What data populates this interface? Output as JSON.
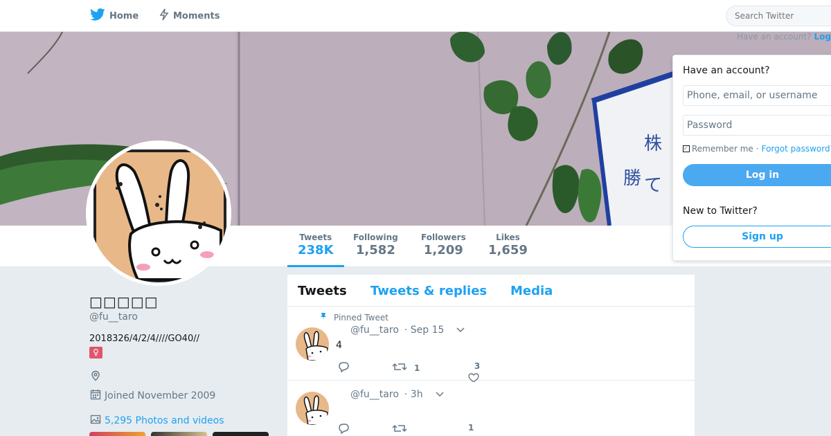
{
  "nav": {
    "home_label": "Home",
    "moments_label": "Moments",
    "search_placeholder": "Search Twitter",
    "have_account_prefix": "Have an account? ",
    "have_account_link": "Log in"
  },
  "colors": {
    "accent": "#1da1f2",
    "background": "#e6ecf0",
    "muted": "#657786",
    "gender_badge": "#e0556d"
  },
  "stats": {
    "tweets_label": "Tweets",
    "tweets_value": "238K",
    "following_label": "Following",
    "following_value": "1,582",
    "followers_label": "Followers",
    "followers_value": "1,209",
    "likes_label": "Likes",
    "likes_value": "1,659"
  },
  "profile": {
    "name": "□□□□□",
    "handle": "@fu__taro",
    "bio": "2018326/4/2/4////GO40//",
    "gender_symbol": "♀",
    "location_icon": "location-pin-icon",
    "joined": "Joined November 2009",
    "photos_link": "5,295 Photos and videos"
  },
  "timeline": {
    "tabs": [
      {
        "label": "Tweets"
      },
      {
        "label": "Tweets & replies"
      },
      {
        "label": "Media"
      }
    ],
    "tweets": [
      {
        "pinned_label": "Pinned Tweet",
        "handle": "@fu__taro",
        "time": "· Sep 15",
        "text": "4",
        "retweets": "1",
        "likes": "3"
      },
      {
        "handle": "@fu__taro",
        "time": "· 3h",
        "text": "",
        "retweets": "",
        "likes": "1"
      }
    ]
  },
  "login": {
    "title": "Have an account?",
    "username_placeholder": "Phone, email, or username",
    "password_placeholder": "Password",
    "remember_label": "Remember me",
    "forgot_label": "Forgot password?",
    "login_button": "Log in",
    "new_label": "New to Twitter?",
    "signup_button": "Sign up"
  }
}
